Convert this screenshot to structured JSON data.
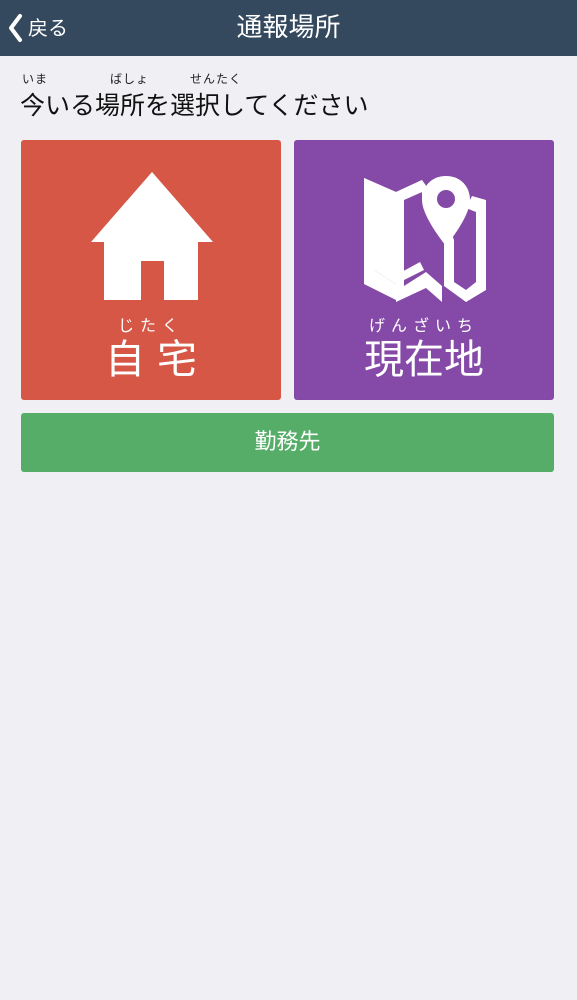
{
  "navbar": {
    "back_label": "戻る",
    "title": "通報場所"
  },
  "instruction": {
    "text": "今いる場所を選択してください",
    "ruby": {
      "ima": "いま",
      "basho": "ばしょ",
      "sentaku": "せんたく"
    }
  },
  "tiles": {
    "home": {
      "ruby": "じたく",
      "label": "自宅",
      "icon": "house-icon",
      "color": "#d75746"
    },
    "current": {
      "ruby": "げんざいち",
      "label": "現在地",
      "icon": "map-pin-icon",
      "color": "#8549a7"
    }
  },
  "work_button": {
    "label": "勤務先",
    "color": "#55ad68"
  },
  "colors": {
    "navbar": "#34495e",
    "background": "#efeff4"
  }
}
